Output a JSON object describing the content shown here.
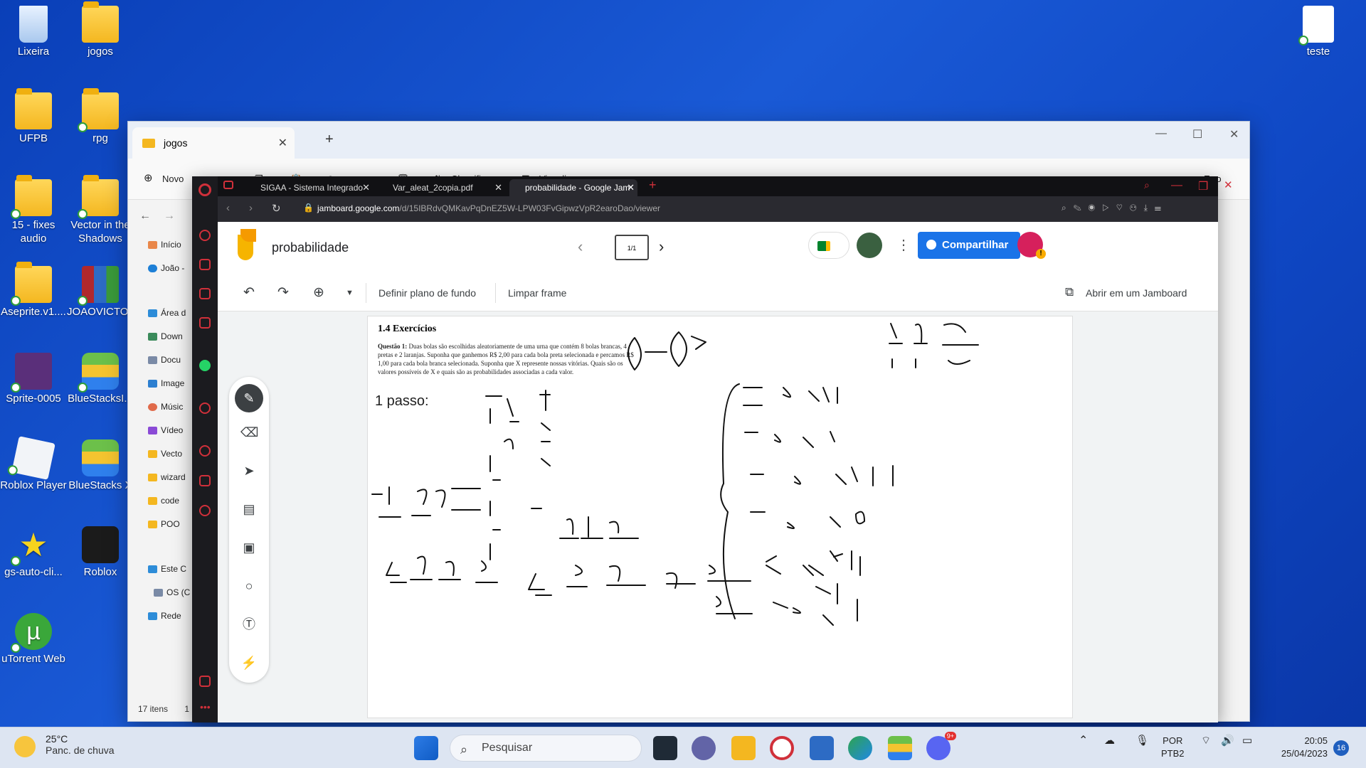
{
  "desktop": {
    "icons": [
      {
        "label": "Lixeira"
      },
      {
        "label": "jogos"
      },
      {
        "label": "UFPB"
      },
      {
        "label": "rpg"
      },
      {
        "label": "15 - fixes audio"
      },
      {
        "label": "Vector in the Shadows"
      },
      {
        "label": "Aseprite.v1...."
      },
      {
        "label": "JOAOVICTO..."
      },
      {
        "label": "Sprite-0005"
      },
      {
        "label": "BlueStacksI..."
      },
      {
        "label": "Roblox Player"
      },
      {
        "label": "BlueStacks X"
      },
      {
        "label": "gs-auto-cli..."
      },
      {
        "label": "Roblox"
      },
      {
        "label": "uTorrent Web"
      },
      {
        "label": "teste"
      }
    ]
  },
  "explorer": {
    "tab_title": "jogos",
    "toolbar": {
      "new_label": "Novo",
      "sort_label": "Classificar",
      "view_label": "Visualizar",
      "more_label": "•••",
      "status_label": "Erro"
    },
    "nav": [
      {
        "label": "Início"
      },
      {
        "label": "João -"
      },
      {
        "label": "Área d"
      },
      {
        "label": "Down"
      },
      {
        "label": "Docu"
      },
      {
        "label": "Image"
      },
      {
        "label": "Músic"
      },
      {
        "label": "Vídeo"
      },
      {
        "label": "Vecto"
      },
      {
        "label": "wizard"
      },
      {
        "label": "code"
      },
      {
        "label": "POO"
      },
      {
        "label": "Este C"
      },
      {
        "label": "OS (C"
      },
      {
        "label": "Rede"
      }
    ],
    "status": "17 itens",
    "status_extra": "1"
  },
  "browser": {
    "tabs": [
      {
        "title": "SIGAA - Sistema Integrado"
      },
      {
        "title": "Var_aleat_2copia.pdf"
      },
      {
        "title": "probabilidade - Google Jam"
      }
    ],
    "url_host": "jamboard.google.com",
    "url_path": "/d/15IBRdvQMKavPqDnEZ5W-LPW03FvGipwzVpR2earoDao/viewer"
  },
  "jamboard": {
    "title": "probabilidade",
    "page_indicator": "1/1",
    "share_label": "Compartilhar",
    "set_background_label": "Definir plano de fundo",
    "clear_frame_label": "Limpar frame",
    "open_in_jamboard_label": "Abrir em um Jamboard",
    "frame": {
      "section_title": "1.4   Exercícios",
      "question_label": "Questão 1:",
      "question_text": "Duas bolas são escolhidas aleatoriamente de uma urna que contém 8 bolas brancas, 4 pretas e 2 laranjas. Suponha que ganhemos R$ 2,00 para cada bola preta selecionada e percamos R$ 1,00 para cada bola branca selecionada. Suponha que X represente nossas vitórias. Quais são os valores possíveis de X e quais são as probabilidades associadas a cada valor.",
      "step_label": "1 passo:"
    }
  },
  "taskbar": {
    "temperature": "25°C",
    "weather_desc": "Panc. de chuva",
    "search_placeholder": "Pesquisar",
    "language": "POR",
    "keyboard": "PTB2",
    "time": "20:05",
    "date": "25/04/2023",
    "notifications": "16",
    "discord_badge": "9+"
  }
}
